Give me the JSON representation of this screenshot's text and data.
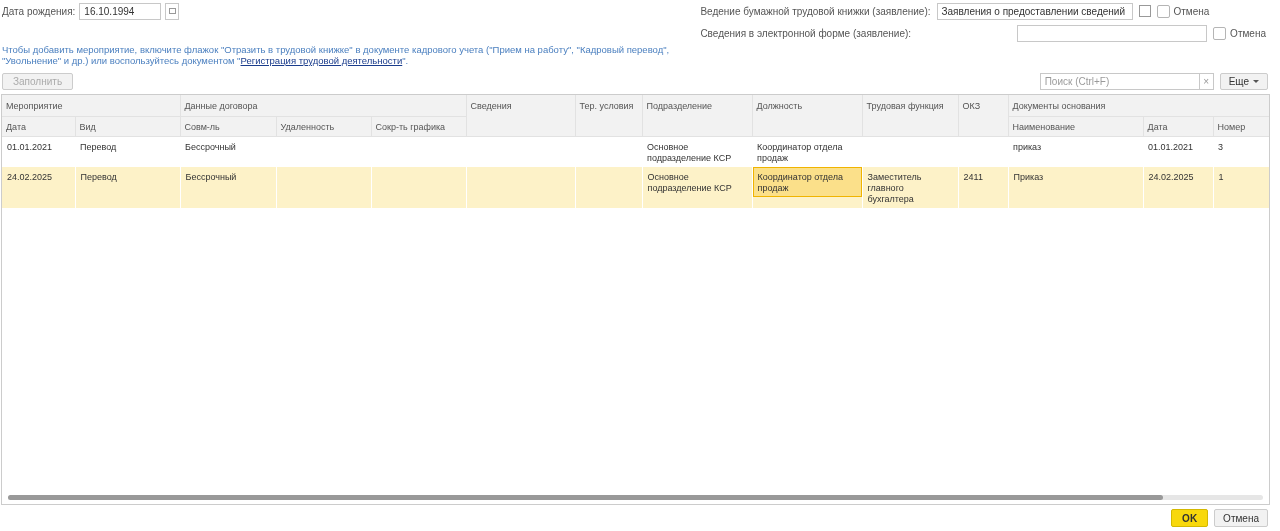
{
  "header": {
    "birth_date": {
      "label": "Дата рождения:",
      "value": "16.10.1994"
    },
    "paper_book": {
      "label": "Ведение бумажной трудовой книжки (заявление):",
      "value": "Заявления о предоставлении сведений",
      "cancel": {
        "label": "Отмена",
        "checked": false
      }
    },
    "electronic": {
      "label": "Сведения в электронной форме (заявление):",
      "cancel": {
        "label": "Отмена",
        "checked": false
      }
    }
  },
  "hint": {
    "text": "Чтобы добавить мероприятие, включите флажок \"Отразить в трудовой книжке\" в документе кадрового учета (\"Прием на работу\", \"Кадровый перевод\", \"Увольнение\" и др.) или воспользуйтесь документом \"",
    "link": "Регистрация трудовой деятельности",
    "tail": "\"."
  },
  "toolbar": {
    "fill_button": {
      "label": "Заполнить",
      "disabled": true
    },
    "search": {
      "placeholder": "Поиск (Ctrl+F)",
      "clear": "×"
    },
    "more_button": "Еще"
  },
  "table": {
    "columns": [
      {
        "label": "Мероприятие",
        "children": [
          "Дата",
          "Вид"
        ]
      },
      {
        "label": "Данные договора",
        "children": [
          "Совм-ль",
          "Удаленность",
          "Сокр-ть графика"
        ]
      },
      {
        "label": "Сведения"
      },
      {
        "label": "Тер. условия"
      },
      {
        "label": "Подразделение"
      },
      {
        "label": "Должность"
      },
      {
        "label": "Трудовая функция"
      },
      {
        "label": "ОКЗ"
      },
      {
        "label": "Документы основания",
        "children": [
          "Наименование",
          "Дата",
          "Номер"
        ]
      }
    ],
    "rows": [
      {
        "selected": false,
        "position_focused": false,
        "date": "01.01.2021",
        "type": "Перевод",
        "combination": "Бессрочный",
        "department": "Основное подразделение КСР",
        "position": "Координатор отдела продаж",
        "doc_name": "приказ",
        "doc_date": "01.01.2021",
        "doc_number": "3"
      },
      {
        "selected": true,
        "position_focused": true,
        "date": "24.02.2025",
        "type": "Перевод",
        "combination": "Бессрочный",
        "department": "Основное подразделение КСР",
        "position": "Координатор отдела продаж",
        "labor_function": "Заместитель главного бухгалтера",
        "okz": "2411",
        "doc_name": "Приказ",
        "doc_date": "24.02.2025",
        "doc_number": "1"
      }
    ]
  },
  "footer": {
    "ok": "OK",
    "cancel": "Отмена"
  }
}
